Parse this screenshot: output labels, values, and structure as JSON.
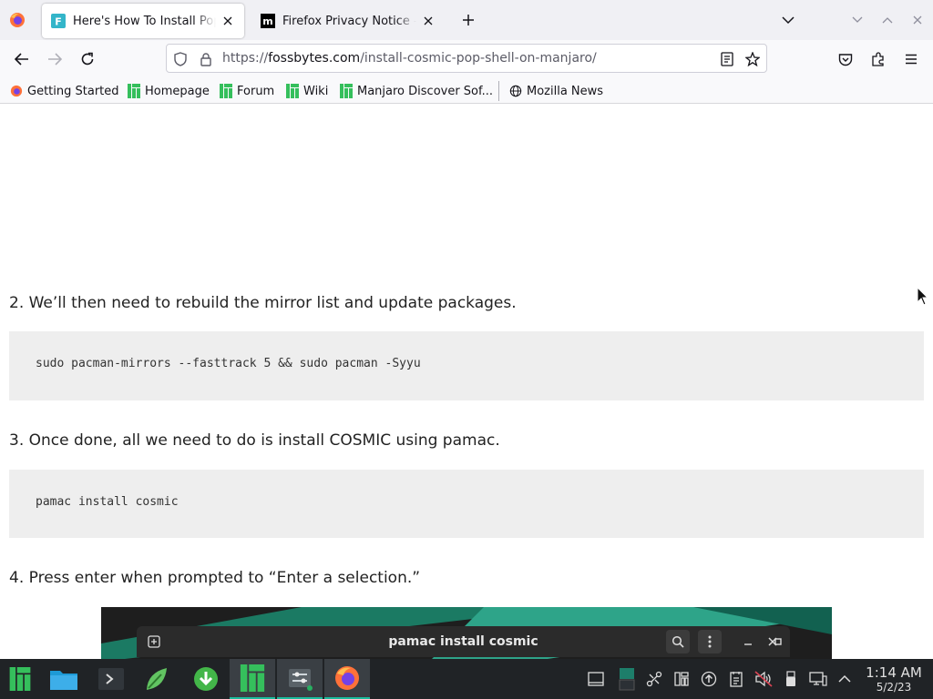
{
  "browser": {
    "tabs": [
      {
        "title": "Here's How To Install Pop!_OS COSMIC",
        "active": true
      },
      {
        "title": "Firefox Privacy Notice — Mozilla",
        "active": false
      }
    ],
    "url_prefix": "https://",
    "url_domain": "fossbytes.com",
    "url_path": "/install-cosmic-pop-shell-on-manjaro/",
    "bookmarks": [
      {
        "label": "Getting Started",
        "icon": "firefox-icon"
      },
      {
        "label": "Homepage",
        "icon": "manjaro-icon"
      },
      {
        "label": "Forum",
        "icon": "manjaro-icon"
      },
      {
        "label": "Wiki",
        "icon": "manjaro-icon"
      },
      {
        "label": "Manjaro Discover Sof...",
        "icon": "manjaro-icon"
      },
      {
        "label": "Mozilla News",
        "icon": "globe-icon"
      }
    ]
  },
  "article": {
    "step2": "2. We’ll then need to rebuild the mirror list and update packages.",
    "code1": "sudo pacman-mirrors --fasttrack 5 && sudo pacman -Syyu",
    "step3": "3. Once done, all we need to do is install COSMIC using pamac.",
    "code2": "pamac install cosmic",
    "step4": "4. Press enter when prompted to “Enter a selection.”",
    "image_window_title": "pamac install cosmic"
  },
  "taskbar": {
    "time": "1:14 AM",
    "date": "5/2/23"
  },
  "colors": {
    "accent": "#1abc9c",
    "manjaro_green": "#35bf5c",
    "code_bg": "#eeeeee"
  }
}
